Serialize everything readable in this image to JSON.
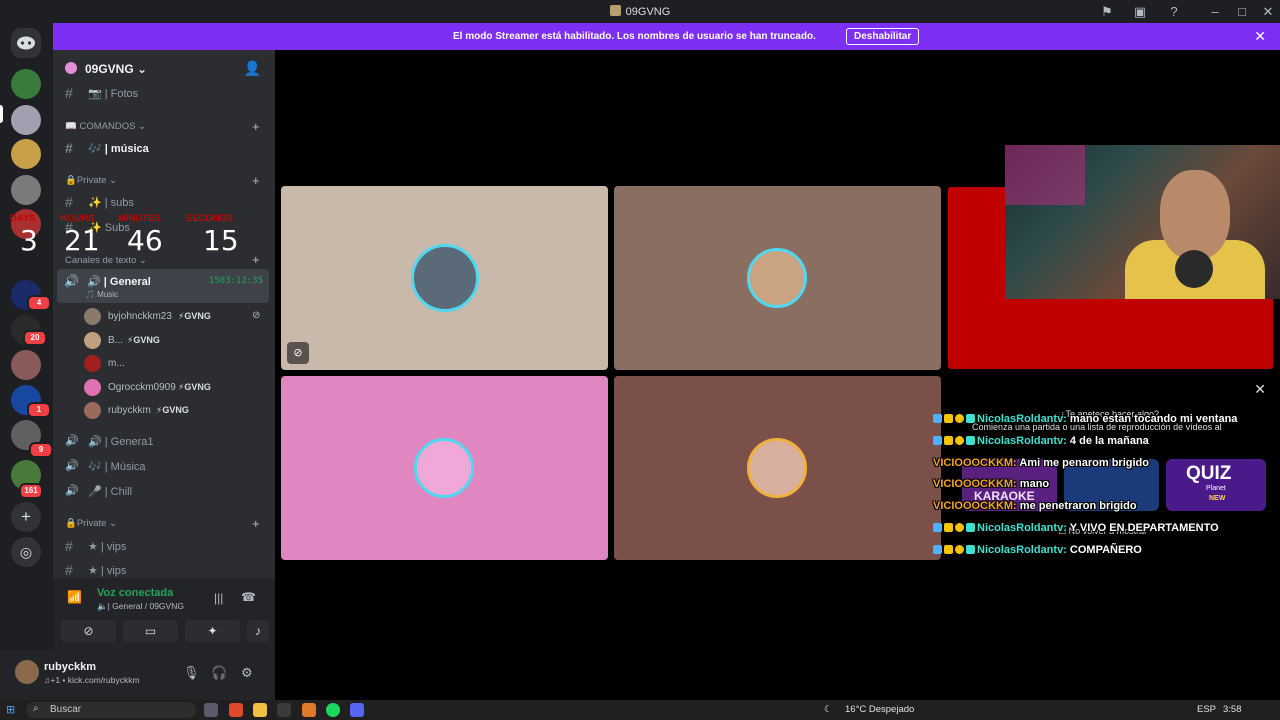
{
  "window": {
    "title": "09GVNG"
  },
  "banner": {
    "text": "El modo Streamer está habilitado. Los nombres de usuario se han truncado.",
    "button": "Deshabilitar"
  },
  "rail": {
    "badges": [
      "4",
      "20",
      "1",
      "9",
      "161",
      "4"
    ]
  },
  "server": {
    "name": "09GVNG"
  },
  "channels": {
    "fotos": "📷 | Fotos",
    "cat_comandos": "📖 COMANDOS ⌄",
    "musica": "🎶 | música",
    "cat_private": "🔒Private ⌄",
    "subs": "✨ | subs",
    "subs2": "✨ Subs",
    "cat_texto": "Canales de texto ⌄",
    "general": "🔊 | General",
    "general_time": "1503:12:35",
    "general_sub": "🎵 Music",
    "general1": "🔊 | Genera1",
    "musica2": "🎶 | Música",
    "chill": "🎤 | Chill",
    "cat_private2": "🔒Private ⌄",
    "vips1": "★ | vips",
    "vips2": "★ | vips"
  },
  "timer": {
    "days_label": "DAYS",
    "hours_label": "HOURS",
    "minutes_label": "MINUTES",
    "seconds_label": "SECONDS",
    "days": "3",
    "hours": "21",
    "minutes": "46",
    "seconds": "15"
  },
  "voice_users": [
    {
      "name": "byjohnckkm23",
      "tag": "⚡GVNG",
      "color": "#8a7a6a"
    },
    {
      "name": "B...",
      "tag": "⚡GVNG",
      "color": "#c0a080"
    },
    {
      "name": "m...",
      "tag": "",
      "color": "#a02020"
    },
    {
      "name": "Ogrocckm0909",
      "tag": "⚡GVNG",
      "color": "#e070b0"
    },
    {
      "name": "rubyckkm",
      "tag": "⚡GVNG",
      "color": "#9a6a5a"
    }
  ],
  "voice_panel": {
    "status": "Voz conectada",
    "sub": "🔈| General / 09GVNG"
  },
  "user": {
    "name": "rubyckkm",
    "status": "♫+1 • kick.com/rubyckkm"
  },
  "chat": [
    {
      "user": "NicolasRoldantv:",
      "msg": "mano estan tocando mi ventana",
      "style": "u1",
      "prefix": true
    },
    {
      "user": "NicolasRoldantv:",
      "msg": "4 de la mañana",
      "style": "u1",
      "prefix": true
    },
    {
      "user": "VICIOOOCKKM:",
      "msg": "Ami me penarom brigido",
      "style": "u2",
      "prefix": false
    },
    {
      "user": "VICIOOOCKKM:",
      "msg": "mano",
      "style": "u2",
      "prefix": false
    },
    {
      "user": "VICIOOOCKKM:",
      "msg": "me penetraron brigido",
      "style": "u2",
      "prefix": false
    },
    {
      "user": "NicolasRoldantv:",
      "msg": "Y VIVO EN DEPARTAMENTO",
      "style": "u1",
      "prefix": true
    },
    {
      "user": "NicolasRoldantv:",
      "msg": "COMPAÑERO",
      "style": "u1",
      "prefix": true
    }
  ],
  "activity": {
    "title": "¿Te apetece hacer algo?",
    "desc": "Comienza una partida o una lista de reproducción de vídeos al",
    "karaoke": "KARAOKE",
    "quiz": "QUIZ",
    "quiz_sub": "Planet",
    "quiz_new": "NEW",
    "dont_show": "No volver a mostrar"
  },
  "taskbar": {
    "search": "Buscar",
    "weather": "16°C  Despejado",
    "lang": "ESP",
    "time": "3:58"
  },
  "colors": {
    "accent": "#7e2ff4",
    "tile1": "#c8b9ab",
    "tile2": "#8a6e62",
    "tile3": "#c00000",
    "tile4": "#e086c0",
    "tile5": "#7a5048",
    "voice_green": "#23a55a"
  }
}
